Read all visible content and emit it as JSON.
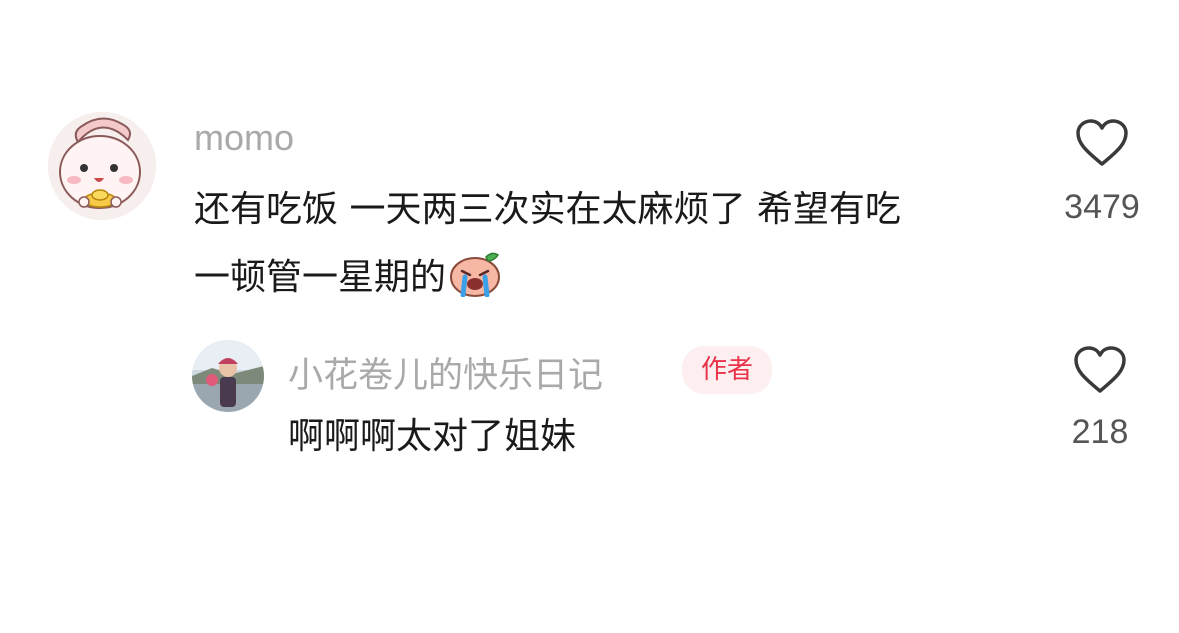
{
  "comments": [
    {
      "username": "momo",
      "text_line1": "还有吃饭 一天两三次实在太麻烦了 希望有吃",
      "text_line2": "一顿管一星期的",
      "emoji": "crying-face-emoji",
      "likes": "3479",
      "avatar": "cartoon-girl-avatar"
    },
    {
      "username": "小花卷儿的快乐日记",
      "badge": "作者",
      "text": "啊啊啊太对了姐妹",
      "likes": "218",
      "avatar": "photo-avatar"
    }
  ],
  "colors": {
    "username": "#a9a9a9",
    "badge_text": "#e8334a",
    "badge_bg": "#fdeff0",
    "body_text": "#1a1a1a"
  }
}
